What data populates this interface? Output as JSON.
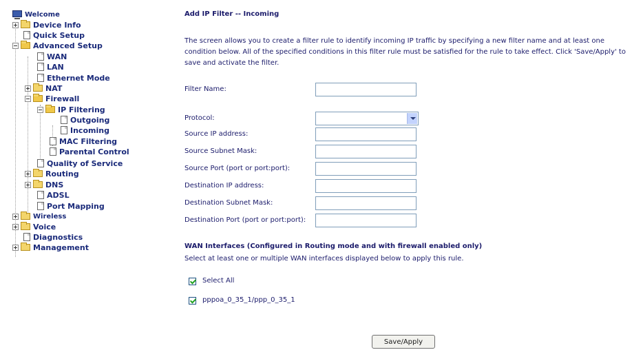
{
  "tree": {
    "welcome": "Welcome",
    "device_info": "Device Info",
    "quick_setup": "Quick Setup",
    "advanced_setup": "Advanced Setup",
    "wan": "WAN",
    "lan": "LAN",
    "ethernet_mode": "Ethernet Mode",
    "nat": "NAT",
    "firewall": "Firewall",
    "ip_filtering": "IP Filtering",
    "outgoing": "Outgoing",
    "incoming": "Incoming",
    "mac_filtering": "MAC Filtering",
    "parental_control": "Parental Control",
    "qos": "Quality of Service",
    "routing": "Routing",
    "dns": "DNS",
    "adsl": "ADSL",
    "port_mapping": "Port Mapping",
    "wireless": "Wireless",
    "voice": "Voice",
    "diagnostics": "Diagnostics",
    "management": "Management"
  },
  "main": {
    "title": "Add IP Filter -- Incoming",
    "description": "The screen allows you to create a filter rule to identify incoming IP traffic by specifying a new filter name and at least one condition below. All of the specified conditions in this filter rule must be satisfied for the rule to take effect. Click 'Save/Apply' to save and activate the filter.",
    "fields": {
      "filter_name": {
        "label": "Filter Name:",
        "value": ""
      },
      "protocol": {
        "label": "Protocol:",
        "value": ""
      },
      "src_ip": {
        "label": "Source IP address:",
        "value": ""
      },
      "src_mask": {
        "label": "Source Subnet Mask:",
        "value": ""
      },
      "src_port": {
        "label": "Source Port (port or port:port):",
        "value": ""
      },
      "dst_ip": {
        "label": "Destination IP address:",
        "value": ""
      },
      "dst_mask": {
        "label": "Destination Subnet Mask:",
        "value": ""
      },
      "dst_port": {
        "label": "Destination Port (port or port:port):",
        "value": ""
      }
    },
    "wan_heading": "WAN Interfaces (Configured in Routing mode and with firewall enabled only)",
    "wan_sub": "Select at least one or multiple WAN interfaces displayed below to apply this rule.",
    "select_all": {
      "label": "Select All",
      "checked": true
    },
    "interface": {
      "label": "pppoa_0_35_1/ppp_0_35_1",
      "checked": true
    },
    "save_button": "Save/Apply"
  },
  "colors": {
    "text": "#1a1a6a",
    "folder": "#f3d56b",
    "border": "#7f9db9"
  }
}
